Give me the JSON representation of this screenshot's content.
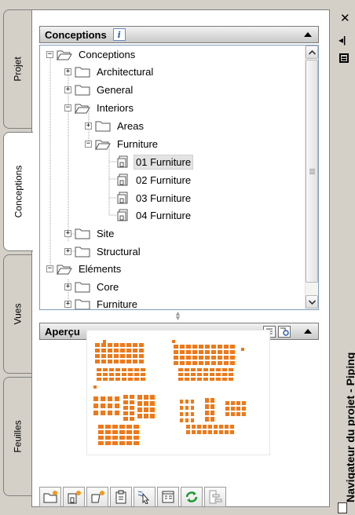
{
  "palette_title": "Navigateur du projet - Piping",
  "side_tabs": [
    {
      "label": "Projet",
      "active": false
    },
    {
      "label": "Conceptions",
      "active": true
    },
    {
      "label": "Vues",
      "active": false
    },
    {
      "label": "Feuilles",
      "active": false
    }
  ],
  "conceptions_panel": {
    "title": "Conceptions",
    "info_icon_glyph": "i",
    "tree": [
      {
        "label": "Conceptions",
        "toggle": "−",
        "icon": "folder-open-icon"
      },
      {
        "label": "Architectural",
        "toggle": "+",
        "icon": "folder-icon"
      },
      {
        "label": "General",
        "toggle": "+",
        "icon": "folder-icon"
      },
      {
        "label": "Interiors",
        "toggle": "−",
        "icon": "folder-open-icon"
      },
      {
        "label": "Areas",
        "toggle": "+",
        "icon": "folder-icon"
      },
      {
        "label": "Furniture",
        "toggle": "−",
        "icon": "folder-open-icon"
      },
      {
        "label": "01 Furniture",
        "toggle": "",
        "icon": "construct-icon",
        "selected": true
      },
      {
        "label": "02 Furniture",
        "toggle": "",
        "icon": "construct-icon"
      },
      {
        "label": "03 Furniture",
        "toggle": "",
        "icon": "construct-icon"
      },
      {
        "label": "04 Furniture",
        "toggle": "",
        "icon": "construct-icon"
      },
      {
        "label": "Site",
        "toggle": "+",
        "icon": "folder-icon"
      },
      {
        "label": "Structural",
        "toggle": "+",
        "icon": "folder-icon"
      },
      {
        "label": "Eléments",
        "toggle": "−",
        "icon": "folder-open-icon"
      },
      {
        "label": "Core",
        "toggle": "+",
        "icon": "folder-icon"
      },
      {
        "label": "Furniture",
        "toggle": "+",
        "icon": "folder-icon"
      }
    ]
  },
  "preview_panel": {
    "title": "Aperçu"
  },
  "toolbar_icons": [
    "add-category-icon",
    "add-construct-icon",
    "add-element-icon",
    "clipboard-icon",
    "select-icon",
    "properties-icon",
    "refresh-icon",
    "hierarchy-icon"
  ],
  "colors": {
    "preview_drawing": "#f07818",
    "selection_bg": "#e3e3e3",
    "frame_bg": "#d4d0c8"
  }
}
